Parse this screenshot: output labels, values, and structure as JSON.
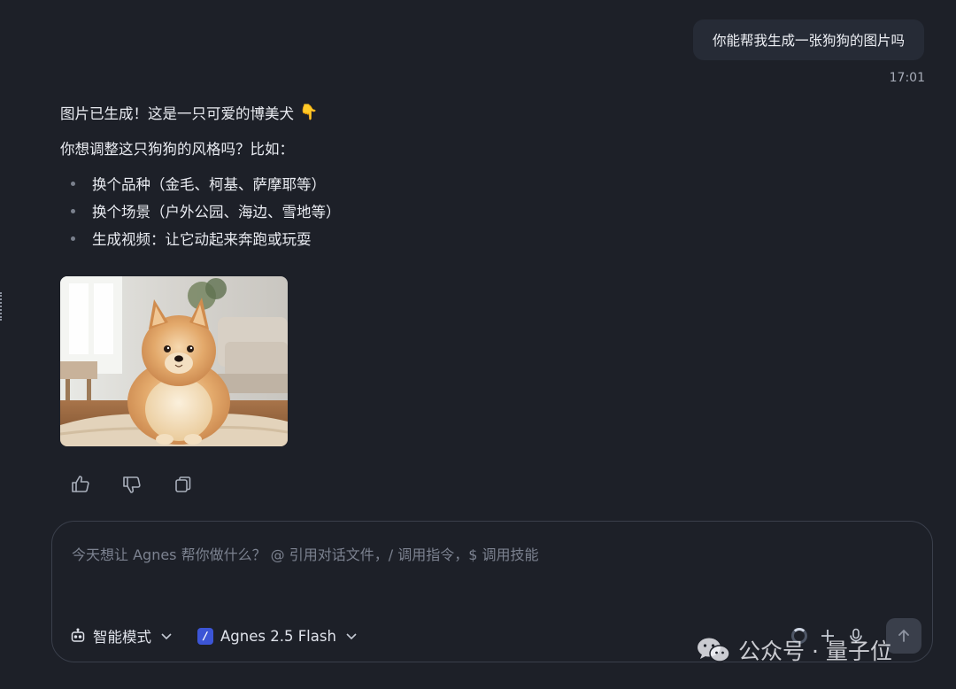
{
  "user_message": {
    "text": "你能帮我生成一张狗狗的图片吗",
    "time": "17:01"
  },
  "assistant_reply": {
    "line1": "图片已生成！这是一只可爱的博美犬",
    "line1_emoji": "👇",
    "line2": "你想调整这只狗狗的风格吗？比如：",
    "bullets": [
      "换个品种（金毛、柯基、萨摩耶等）",
      "换个场景（户外公园、海边、雪地等）",
      "生成视频：让它动起来奔跑或玩耍"
    ],
    "image": "pomeranian-photo"
  },
  "feedback_actions": [
    "thumbs-up-icon",
    "thumbs-down-icon",
    "copy-icon"
  ],
  "composer": {
    "placeholder": "今天想让 Agnes 帮你做什么？ @ 引用对话文件，/ 调用指令，$ 调用技能",
    "value": "",
    "mode_label": "智能模式",
    "model_label": "Agnes 2.5 Flash"
  },
  "watermark": {
    "text": "公众号 · 量子位"
  },
  "colors": {
    "background": "#1d2028",
    "bubble": "#262b36",
    "accent": "#3c55d6",
    "muted": "#7c8290"
  }
}
